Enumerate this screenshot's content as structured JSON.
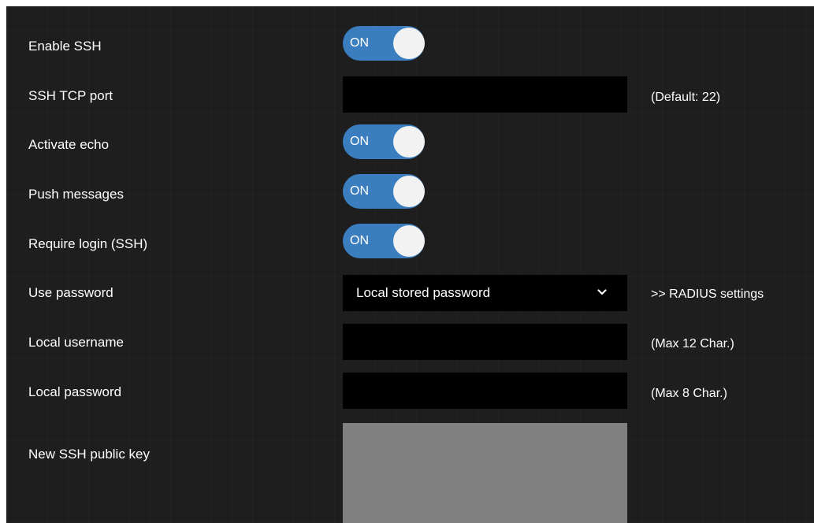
{
  "settings": {
    "enable_ssh": {
      "label": "Enable SSH",
      "state": "ON"
    },
    "ssh_tcp_port": {
      "label": "SSH TCP port",
      "value": "",
      "hint": "(Default: 22)"
    },
    "activate_echo": {
      "label": "Activate echo",
      "state": "ON"
    },
    "push_messages": {
      "label": "Push messages",
      "state": "ON"
    },
    "require_login": {
      "label": "Require login (SSH)",
      "state": "ON"
    },
    "use_password": {
      "label": "Use password",
      "selected": "Local stored password",
      "link": ">> RADIUS settings"
    },
    "local_username": {
      "label": "Local username",
      "value": "",
      "hint": "(Max 12 Char.)"
    },
    "local_password": {
      "label": "Local password",
      "value": "",
      "hint": "(Max 8 Char.)"
    },
    "new_ssh_public_key": {
      "label": "New SSH public key",
      "value": ""
    }
  },
  "colors": {
    "panel_background": "#1e1e1e",
    "toggle_on": "#3a7ebf",
    "toggle_knob": "#f2f2f2",
    "input_background": "#000000",
    "textarea_background": "#808080",
    "text": "#ffffff"
  },
  "icons": {
    "select_arrow": "chevron-down-icon"
  }
}
